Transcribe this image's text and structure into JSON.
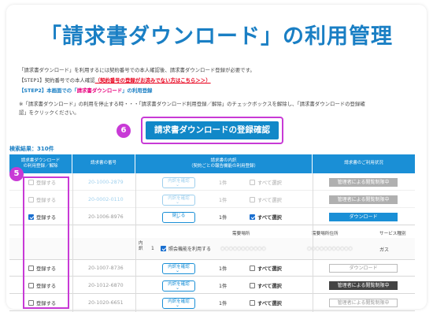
{
  "title": "「請求書ダウンロード」の利用管理",
  "intro": {
    "line1": "「請求書ダウンロード」を利用するには契約番号での本人確認後、請求書ダウンロード登録が必要です。",
    "step1_label": "【STEP1】契約番号での本人確認",
    "step1_link": "（契約番号の登録がお済みでない方はこちら＞＞）",
    "step2_label": "【STEP2】本画面での「",
    "step2_emph": "請求書ダウンロード",
    "step2_tail": "」の利用登録",
    "note1": "※「請求書ダウンロード」の利用を停止する時・・・「請求書ダウンロード利用登録／解除」のチェックボックスを解除し、「請求書ダウンロードの登録確",
    "note2": "認」をクリックください。"
  },
  "cta_label": "請求書ダウンロードの登録確認",
  "badges": {
    "cta": "6",
    "checkbox_column": "5"
  },
  "results_label": "検索結果：310件",
  "table": {
    "headers": {
      "col1": "請求書ダウンロード\nの利用登録／解除",
      "col2": "請求書の番号",
      "col3": "請求書の内訳\n（契約ごとの報告機能の利用登録）",
      "col4": "請求書のご利用状況"
    },
    "rows": [
      {
        "register": "登録する",
        "checked": false,
        "number": "20-1000-2879",
        "detail_button": "内訳を確認",
        "count": "1件",
        "select_all": "すべて選択",
        "select_checked": false,
        "status": "管理者による閲覧制限中",
        "status_kind": "dark",
        "faded": true
      },
      {
        "register": "登録する",
        "checked": false,
        "number": "20-0002-0110",
        "detail_button": "内訳を確認",
        "count": "1件",
        "select_all": "すべて選択",
        "select_checked": false,
        "status": "管理者による閲覧制限中",
        "status_kind": "dark",
        "faded": true
      },
      {
        "register": "登録する",
        "checked": true,
        "number": "20-1006-8976",
        "detail_button": "閉じる",
        "count": "1件",
        "select_all": "すべて選択",
        "select_checked": true,
        "status": "ダウンロード",
        "status_kind": "blue",
        "faded": false
      },
      {
        "register": "登録する",
        "checked": false,
        "number": "20-1007-8736",
        "detail_button": "内訳を確認",
        "count": "1件",
        "select_all": "すべて選択",
        "select_checked": false,
        "status": "ダウンロード",
        "status_kind": "empty",
        "faded": false
      },
      {
        "register": "登録する",
        "checked": false,
        "number": "20-1012-6870",
        "detail_button": "内訳を確認",
        "count": "1件",
        "select_all": "すべて選択",
        "select_checked": false,
        "status": "管理者による閲覧制限中",
        "status_kind": "dark",
        "faded": false
      },
      {
        "register": "登録する",
        "checked": false,
        "number": "20-1020-6651",
        "detail_button": "内訳を確認",
        "count": "1件",
        "select_all": "すべて選択",
        "select_checked": false,
        "status": "管理者による閲覧制限中",
        "status_kind": "empty",
        "faded": false
      }
    ],
    "detail_subheader": {
      "place": "需要場所",
      "address": "需要場所住所",
      "service": "サービス種別"
    },
    "detail_row": {
      "label": "内訳",
      "index": "1",
      "report_label": "照会機能を利用する",
      "place": "○○○○○○○○○○○",
      "address": "○○○○○○○○○○○",
      "service": "ガス"
    }
  }
}
